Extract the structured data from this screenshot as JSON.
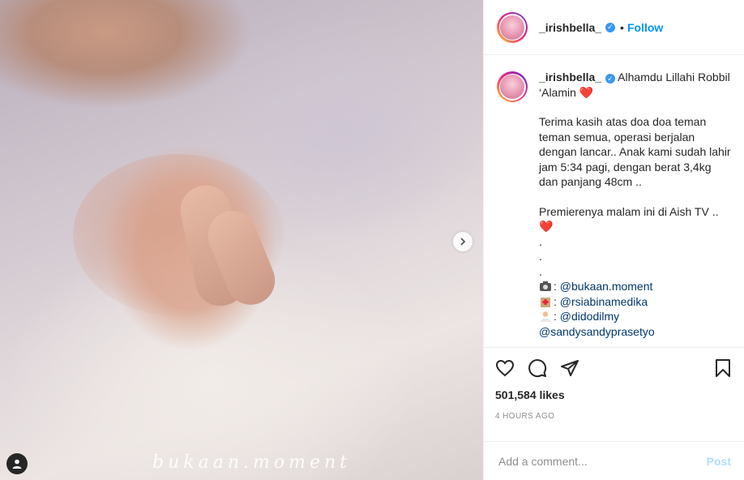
{
  "header": {
    "username": "_irishbella_",
    "verified_icon": "verified-badge-icon",
    "separator": "•",
    "follow_label": "Follow"
  },
  "media": {
    "watermark": "bukaan.moment",
    "next_icon": "chevron-right-icon",
    "user_tag_icon": "user-icon"
  },
  "caption": {
    "username": "_irishbella_",
    "line1": "Alhamdu Lillahi Robbil ‘Alamin",
    "heart": "❤️",
    "para2": "Terima kasih atas doa doa teman teman semua, operasi berjalan dengan lancar.. Anak kami sudah lahir jam 5:34 pagi, dengan berat 3,4kg dan panjang 48cm ..",
    "para3": "Premierenya malam ini di Aish TV ..",
    "heart2": "❤️",
    "dots": [
      ".",
      ".",
      "."
    ],
    "credits": [
      {
        "icon": "camera-emoji-icon",
        "prefix": ": ",
        "mention": "@bukaan.moment"
      },
      {
        "icon": "hospital-emoji-icon",
        "prefix": ": ",
        "mention": "@rsiabinamedika"
      },
      {
        "icon": "doctor-emoji-icon",
        "prefix": ": ",
        "mention": "@didodilmy"
      }
    ],
    "extra_mention": "@sandysandyprasetyo",
    "time_ago": "4h"
  },
  "actions": {
    "likes": "501,584 likes",
    "posted": "4 HOURS AGO"
  },
  "comment": {
    "placeholder": "Add a comment...",
    "post_label": "Post"
  },
  "colors": {
    "accent": "#0095f6",
    "mention": "#00376b",
    "muted": "#8e8e8e",
    "post_disabled": "#b2dffc"
  }
}
